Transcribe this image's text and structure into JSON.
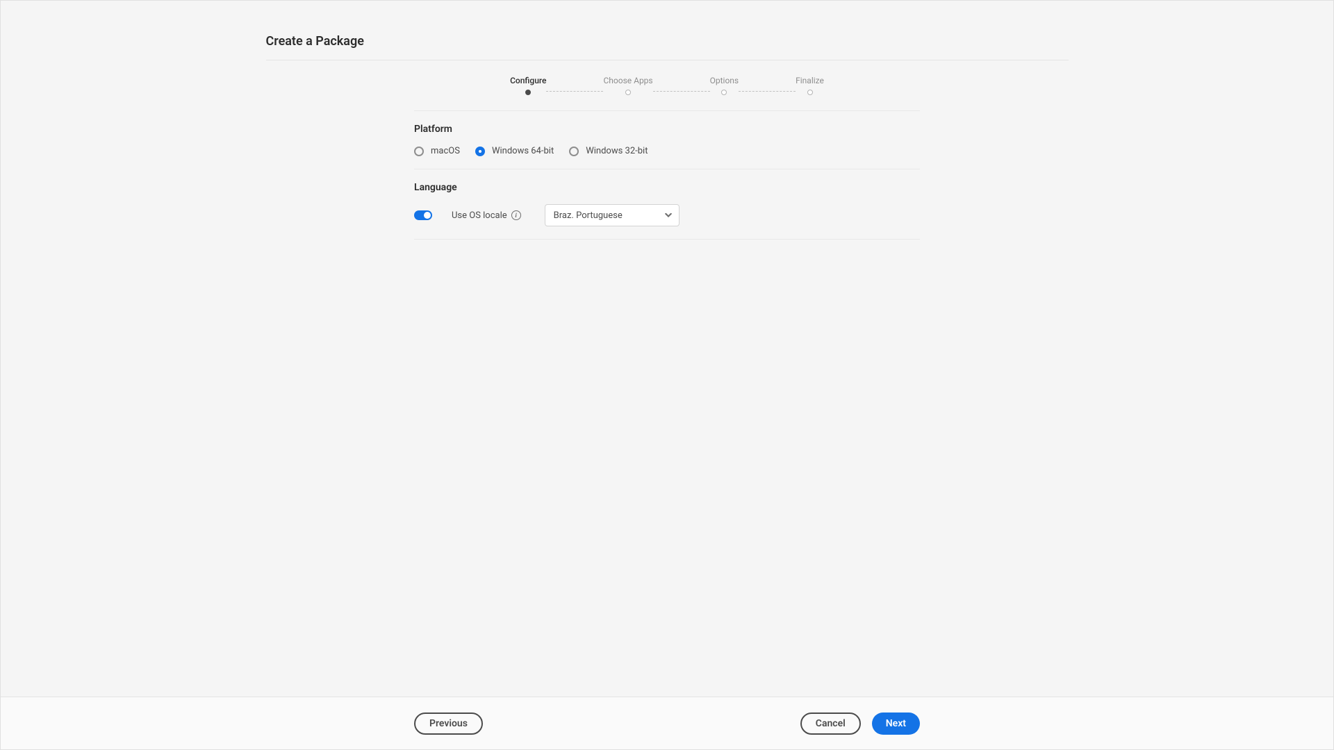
{
  "header": {
    "title": "Create a Package"
  },
  "stepper": {
    "steps": [
      {
        "label": "Configure"
      },
      {
        "label": "Choose Apps"
      },
      {
        "label": "Options"
      },
      {
        "label": "Finalize"
      }
    ]
  },
  "platform": {
    "title": "Platform",
    "options": {
      "macos": "macOS",
      "win64": "Windows 64-bit",
      "win32": "Windows 32-bit"
    }
  },
  "language": {
    "title": "Language",
    "toggle_label": "Use OS locale",
    "dropdown_value": "Braz. Portuguese"
  },
  "footer": {
    "previous": "Previous",
    "cancel": "Cancel",
    "next": "Next"
  }
}
